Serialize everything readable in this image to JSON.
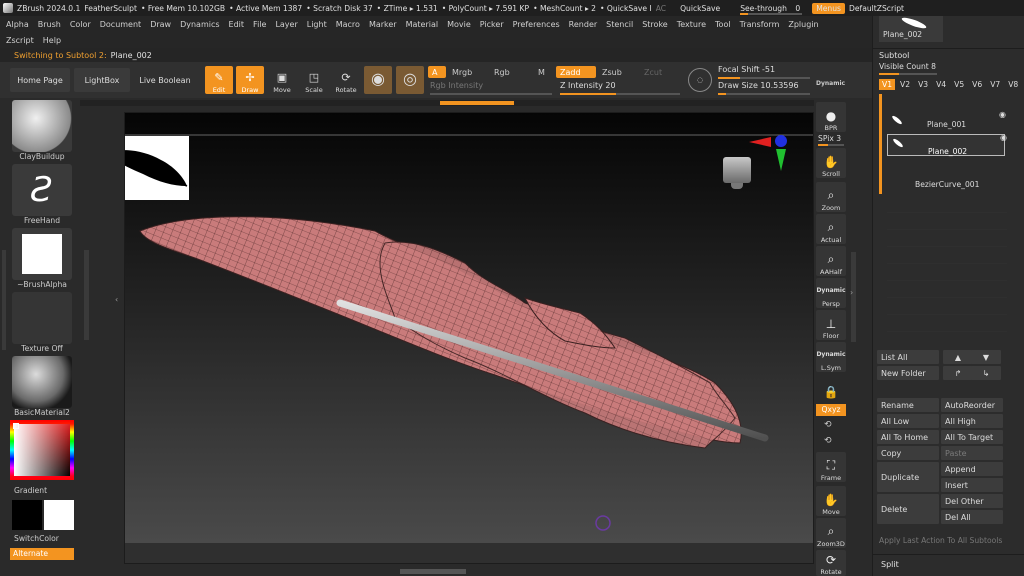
{
  "titlebar": {
    "app": "ZBrush 2024.0.1",
    "document": "FeatherSculpt",
    "free_mem": "• Free Mem 10.102GB",
    "active_mem": "• Active Mem 1387",
    "scratch_disk": "• Scratch Disk 37",
    "ztime": "• ZTime ▸ 1.531",
    "polycount": "• PolyCount ▸ 7.591 KP",
    "meshcount": "• MeshCount ▸ 2",
    "quicksave_i": "• QuickSave I",
    "ac": "AC",
    "quicksave": "QuickSave",
    "seethrough_label": "See-through",
    "seethrough_value": "0",
    "menus": "Menus",
    "defaultzscript": "DefaultZScript"
  },
  "menubar": {
    "row1": [
      "Alpha",
      "Brush",
      "Color",
      "Document",
      "Draw",
      "Dynamics",
      "Edit",
      "File",
      "Layer",
      "Light",
      "Macro",
      "Marker",
      "Material",
      "Movie",
      "Picker",
      "Preferences",
      "Render",
      "Stencil",
      "Stroke",
      "Texture",
      "Tool",
      "Transform",
      "Zplugin"
    ],
    "row2": [
      "Zscript",
      "Help"
    ]
  },
  "status": {
    "switching_label": "Switching to Subtool 2:",
    "switching_value": "Plane_002"
  },
  "toolbar": {
    "home_page": "Home Page",
    "lightbox": "LightBox",
    "live_boolean": "Live Boolean",
    "edit": "Edit",
    "draw": "Draw",
    "move": "Move",
    "scale": "Scale",
    "rotate": "Rotate",
    "a": "A",
    "mrgb": "Mrgb",
    "rgb": "Rgb",
    "m": "M",
    "zadd": "Zadd",
    "zsub": "Zsub",
    "zcut": "Zcut",
    "rgb_intensity": "Rgb Intensity",
    "z_intensity": "Z Intensity 20",
    "focal_shift": "Focal Shift -51",
    "draw_size": "Draw Size 10.53596",
    "dynamic": "Dynamic"
  },
  "leftpanel": {
    "brush": "ClayBuildup",
    "stroke": "FreeHand",
    "alpha": "~BrushAlpha",
    "texture": "Texture Off",
    "material": "BasicMaterial2",
    "gradient": "Gradient",
    "switchcolor": "SwitchColor",
    "alternate": "Alternate"
  },
  "rightstrip": {
    "bpr": "BPR",
    "spix": "SPix 3",
    "scroll": "Scroll",
    "zoom": "Zoom",
    "actual": "Actual",
    "aahalf": "AAHalf",
    "dynamic_persp": "Dynamic",
    "persp": "Persp",
    "floor": "Floor",
    "dynamic_lsym": "Dynamic",
    "lsym": "L.Sym",
    "qxyz": "Qxyz",
    "frame": "Frame",
    "move": "Move",
    "zoom3d": "Zoom3D",
    "rotate": "Rotate"
  },
  "subtool": {
    "top_thumb_label": "Plane_002",
    "title": "Subtool",
    "visible_count": "Visible Count 8",
    "versions": [
      "V1",
      "V2",
      "V3",
      "V4",
      "V5",
      "V6",
      "V7",
      "V8"
    ],
    "items": [
      "Plane_001",
      "Plane_002",
      "BezierCurve_001"
    ],
    "list_all": "List All",
    "new_folder": "New Folder",
    "rename": "Rename",
    "autoreorder": "AutoReorder",
    "all_low": "All Low",
    "all_high": "All High",
    "all_to_home": "All To Home",
    "all_to_target": "All To Target",
    "copy": "Copy",
    "paste": "Paste",
    "duplicate": "Duplicate",
    "append": "Append",
    "insert": "Insert",
    "delete": "Delete",
    "del_other": "Del Other",
    "del_all": "Del All",
    "apply_last": "Apply Last Action To All Subtools",
    "split": "Split"
  },
  "colors": {
    "accent": "#f39420",
    "mesh": "#c97b7b"
  }
}
